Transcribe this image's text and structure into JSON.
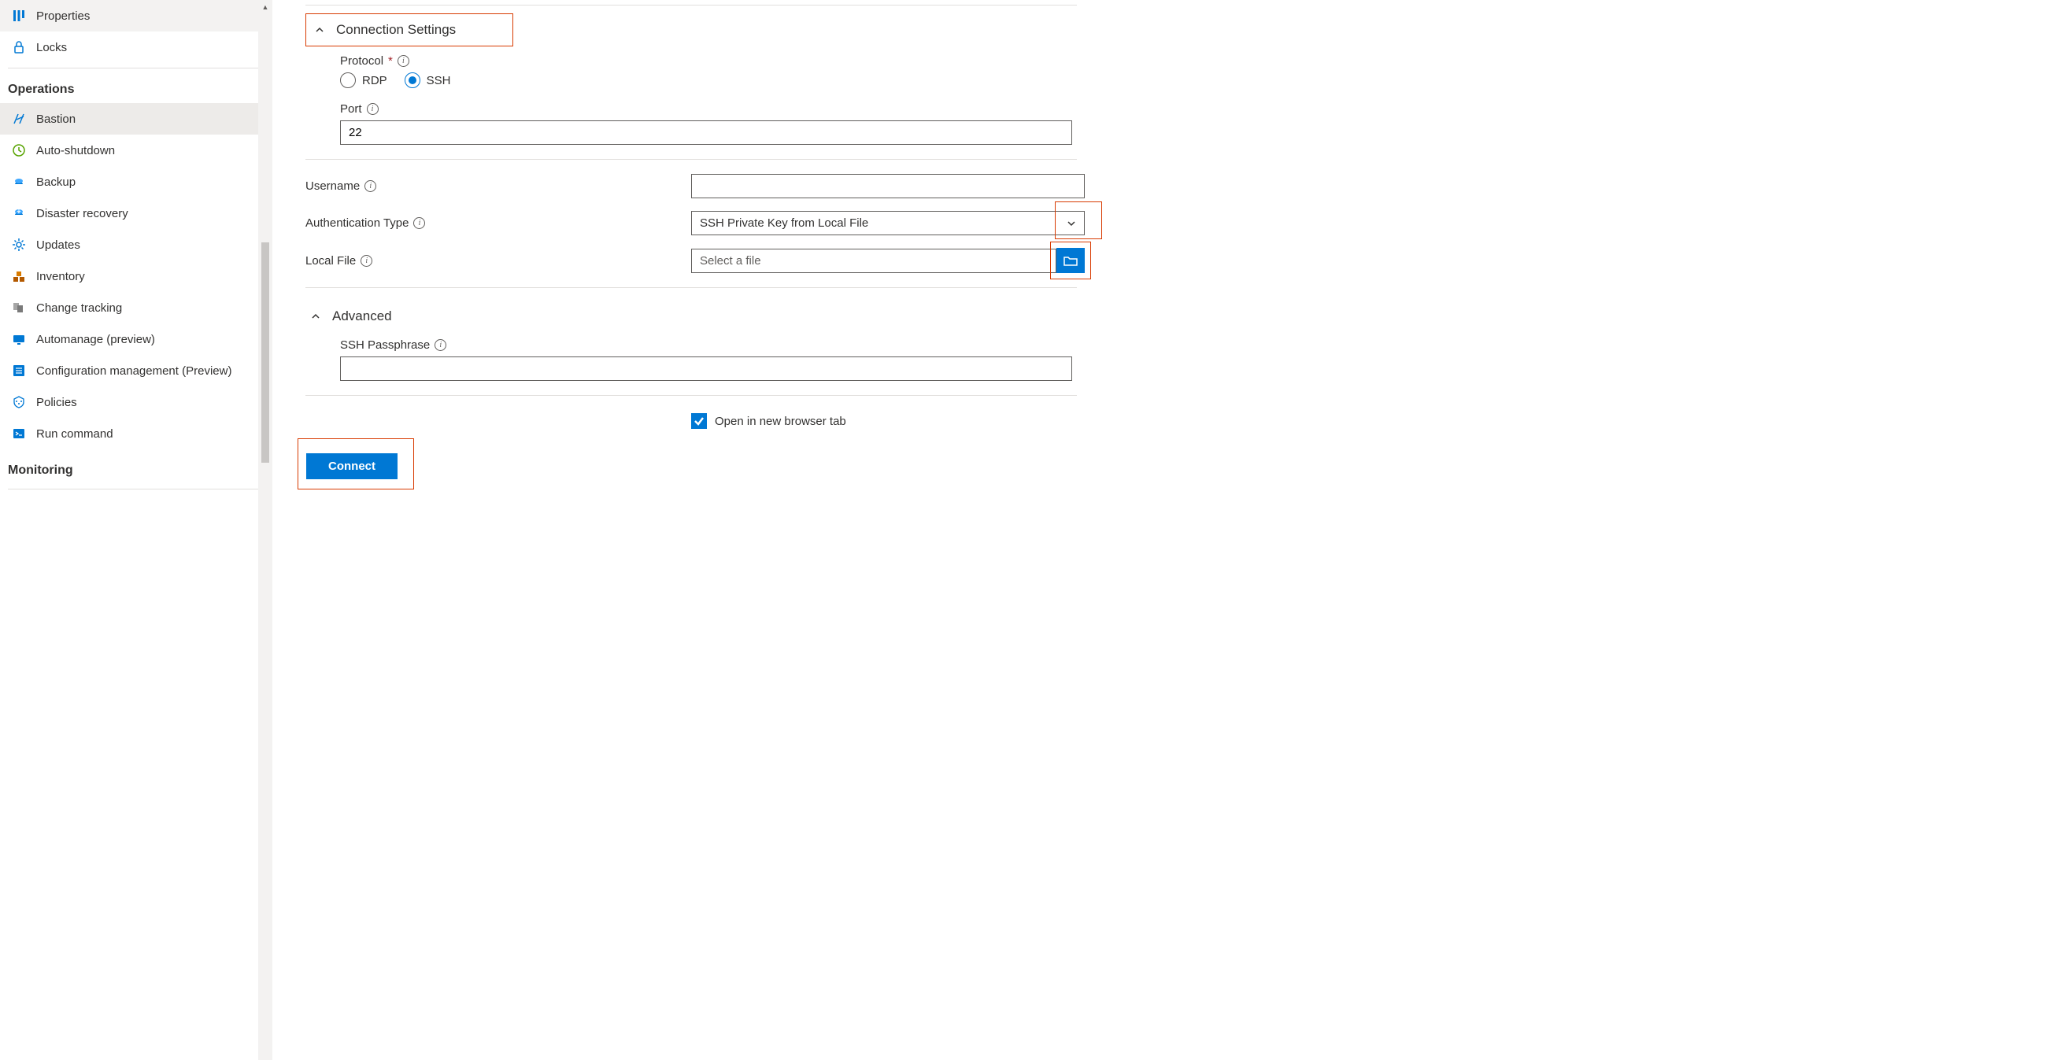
{
  "sidebar": {
    "top_items": [
      {
        "id": "properties",
        "label": "Properties"
      },
      {
        "id": "locks",
        "label": "Locks"
      }
    ],
    "sections": [
      {
        "title": "Operations",
        "items": [
          {
            "id": "bastion",
            "label": "Bastion",
            "active": true
          },
          {
            "id": "auto-shutdown",
            "label": "Auto-shutdown"
          },
          {
            "id": "backup",
            "label": "Backup"
          },
          {
            "id": "disaster-recovery",
            "label": "Disaster recovery"
          },
          {
            "id": "updates",
            "label": "Updates"
          },
          {
            "id": "inventory",
            "label": "Inventory"
          },
          {
            "id": "change-tracking",
            "label": "Change tracking"
          },
          {
            "id": "automanage",
            "label": "Automanage (preview)"
          },
          {
            "id": "config-mgmt",
            "label": "Configuration management (Preview)"
          },
          {
            "id": "policies",
            "label": "Policies"
          },
          {
            "id": "run-command",
            "label": "Run command"
          }
        ]
      },
      {
        "title": "Monitoring",
        "items": []
      }
    ]
  },
  "main": {
    "connection_settings_title": "Connection Settings",
    "protocol_label": "Protocol",
    "protocol_options": {
      "rdp": "RDP",
      "ssh": "SSH"
    },
    "protocol_selected": "ssh",
    "port_label": "Port",
    "port_value": "22",
    "username_label": "Username",
    "username_value": "",
    "auth_type_label": "Authentication Type",
    "auth_type_value": "SSH Private Key from Local File",
    "local_file_label": "Local File",
    "local_file_placeholder": "Select a file",
    "advanced_title": "Advanced",
    "ssh_passphrase_label": "SSH Passphrase",
    "ssh_passphrase_value": "",
    "open_new_tab_label": "Open in new browser tab",
    "open_new_tab_checked": true,
    "connect_label": "Connect"
  }
}
